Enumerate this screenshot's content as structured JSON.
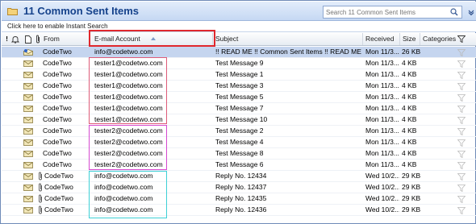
{
  "header": {
    "title": "11 Common Sent Items",
    "search_placeholder": "Search 11 Common Sent Items"
  },
  "instant_search_text": "Click here to enable Instant Search",
  "columns": {
    "from": "From",
    "email_account": "E-mail Account",
    "subject": "Subject",
    "received": "Received",
    "size": "Size",
    "categories": "Categories",
    "importance_icon": "!",
    "reminder_icon": "bell-icon",
    "type_icon": "document-icon",
    "attachment_icon": "paperclip-icon",
    "flag_icon": "flag-filter-icon"
  },
  "sort": {
    "column": "E-mail Account",
    "direction": "ascending"
  },
  "colors": {
    "title_text": "#15428b",
    "selected_row": "#c5d5ef",
    "highlight_header_box": "#e0282d",
    "group_box_tester1": "#de5c79",
    "group_box_tester2": "#d64ad0",
    "group_box_info": "#3ed0d6"
  },
  "messages": [
    {
      "from": "CodeTwo",
      "account": "info@codetwo.com",
      "subject": "!! READ ME !! Common Sent Items !! READ ME !!",
      "received": "Mon 11/3...",
      "size": "26 KB",
      "icon": "envelope-read-icon",
      "attachment": false,
      "selected": true
    },
    {
      "from": "CodeTwo",
      "account": "tester1@codetwo.com",
      "subject": "Test Message 9",
      "received": "Mon 11/3...",
      "size": "4 KB",
      "icon": "envelope-icon",
      "attachment": false,
      "selected": false
    },
    {
      "from": "CodeTwo",
      "account": "tester1@codetwo.com",
      "subject": "Test Message 1",
      "received": "Mon 11/3...",
      "size": "4 KB",
      "icon": "envelope-icon",
      "attachment": false,
      "selected": false
    },
    {
      "from": "CodeTwo",
      "account": "tester1@codetwo.com",
      "subject": "Test Message 3",
      "received": "Mon 11/3...",
      "size": "4 KB",
      "icon": "envelope-icon",
      "attachment": false,
      "selected": false
    },
    {
      "from": "CodeTwo",
      "account": "tester1@codetwo.com",
      "subject": "Test Message 5",
      "received": "Mon 11/3...",
      "size": "4 KB",
      "icon": "envelope-icon",
      "attachment": false,
      "selected": false
    },
    {
      "from": "CodeTwo",
      "account": "tester1@codetwo.com",
      "subject": "Test Message 7",
      "received": "Mon 11/3...",
      "size": "4 KB",
      "icon": "envelope-icon",
      "attachment": false,
      "selected": false
    },
    {
      "from": "CodeTwo",
      "account": "tester1@codetwo.com",
      "subject": "Test Message 10",
      "received": "Mon 11/3...",
      "size": "4 KB",
      "icon": "envelope-icon",
      "attachment": false,
      "selected": false
    },
    {
      "from": "CodeTwo",
      "account": "tester2@codetwo.com",
      "subject": "Test Message 2",
      "received": "Mon 11/3...",
      "size": "4 KB",
      "icon": "envelope-icon",
      "attachment": false,
      "selected": false
    },
    {
      "from": "CodeTwo",
      "account": "tester2@codetwo.com",
      "subject": "Test Message 4",
      "received": "Mon 11/3...",
      "size": "4 KB",
      "icon": "envelope-icon",
      "attachment": false,
      "selected": false
    },
    {
      "from": "CodeTwo",
      "account": "tester2@codetwo.com",
      "subject": "Test Message 8",
      "received": "Mon 11/3...",
      "size": "4 KB",
      "icon": "envelope-icon",
      "attachment": false,
      "selected": false
    },
    {
      "from": "CodeTwo",
      "account": "tester2@codetwo.com",
      "subject": "Test Message 6",
      "received": "Mon 11/3...",
      "size": "4 KB",
      "icon": "envelope-icon",
      "attachment": false,
      "selected": false
    },
    {
      "from": "CodeTwo",
      "account": "info@codetwo.com",
      "subject": "Reply No. 12434",
      "received": "Wed 10/2...",
      "size": "29 KB",
      "icon": "envelope-icon",
      "attachment": true,
      "selected": false
    },
    {
      "from": "CodeTwo",
      "account": "info@codetwo.com",
      "subject": "Reply No. 12437",
      "received": "Wed 10/2...",
      "size": "29 KB",
      "icon": "envelope-icon",
      "attachment": true,
      "selected": false
    },
    {
      "from": "CodeTwo",
      "account": "info@codetwo.com",
      "subject": "Reply No. 12435",
      "received": "Wed 10/2...",
      "size": "29 KB",
      "icon": "envelope-icon",
      "attachment": true,
      "selected": false
    },
    {
      "from": "CodeTwo",
      "account": "info@codetwo.com",
      "subject": "Reply No. 12436",
      "received": "Wed 10/2...",
      "size": "29 KB",
      "icon": "envelope-icon",
      "attachment": true,
      "selected": false
    }
  ]
}
